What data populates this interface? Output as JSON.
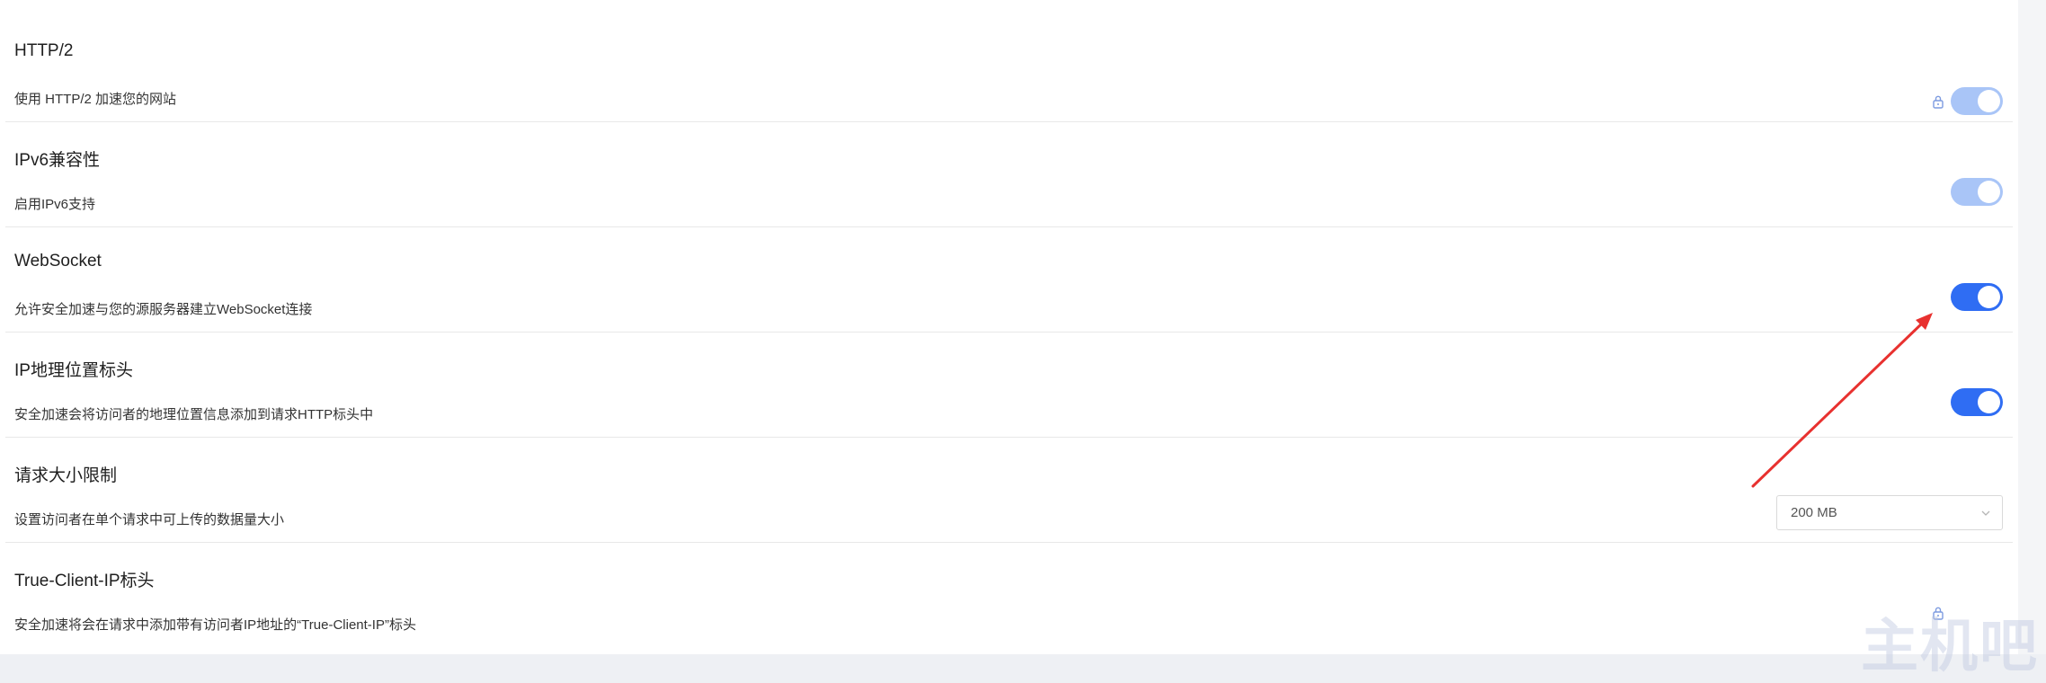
{
  "settings": [
    {
      "title": "HTTP/2",
      "description": "使用 HTTP/2 加速您的网站",
      "control": "toggle",
      "enabled": true,
      "disabled": true,
      "locked": true
    },
    {
      "title": "IPv6兼容性",
      "description": "启用IPv6支持",
      "control": "toggle",
      "enabled": true,
      "disabled": true,
      "locked": false
    },
    {
      "title": "WebSocket",
      "description": "允许安全加速与您的源服务器建立WebSocket连接",
      "control": "toggle",
      "enabled": true,
      "disabled": false,
      "locked": false
    },
    {
      "title": "IP地理位置标头",
      "description": "安全加速会将访问者的地理位置信息添加到请求HTTP标头中",
      "control": "toggle",
      "enabled": true,
      "disabled": false,
      "locked": false
    },
    {
      "title": "请求大小限制",
      "description": "设置访问者在单个请求中可上传的数据量大小",
      "control": "select",
      "selected": "200 MB"
    },
    {
      "title": "True-Client-IP标头",
      "description": "安全加速将会在请求中添加带有访问者IP地址的“True-Client-IP”标头",
      "control": "none",
      "locked": true
    }
  ],
  "icons": {
    "lock": "lock-icon",
    "dropdown": "chevron-down-icon"
  },
  "watermark": "主机吧",
  "colors": {
    "toggle_on": "#2f6df3",
    "toggle_disabled": "#a9c5f7",
    "annotation_arrow": "#e8312f"
  }
}
